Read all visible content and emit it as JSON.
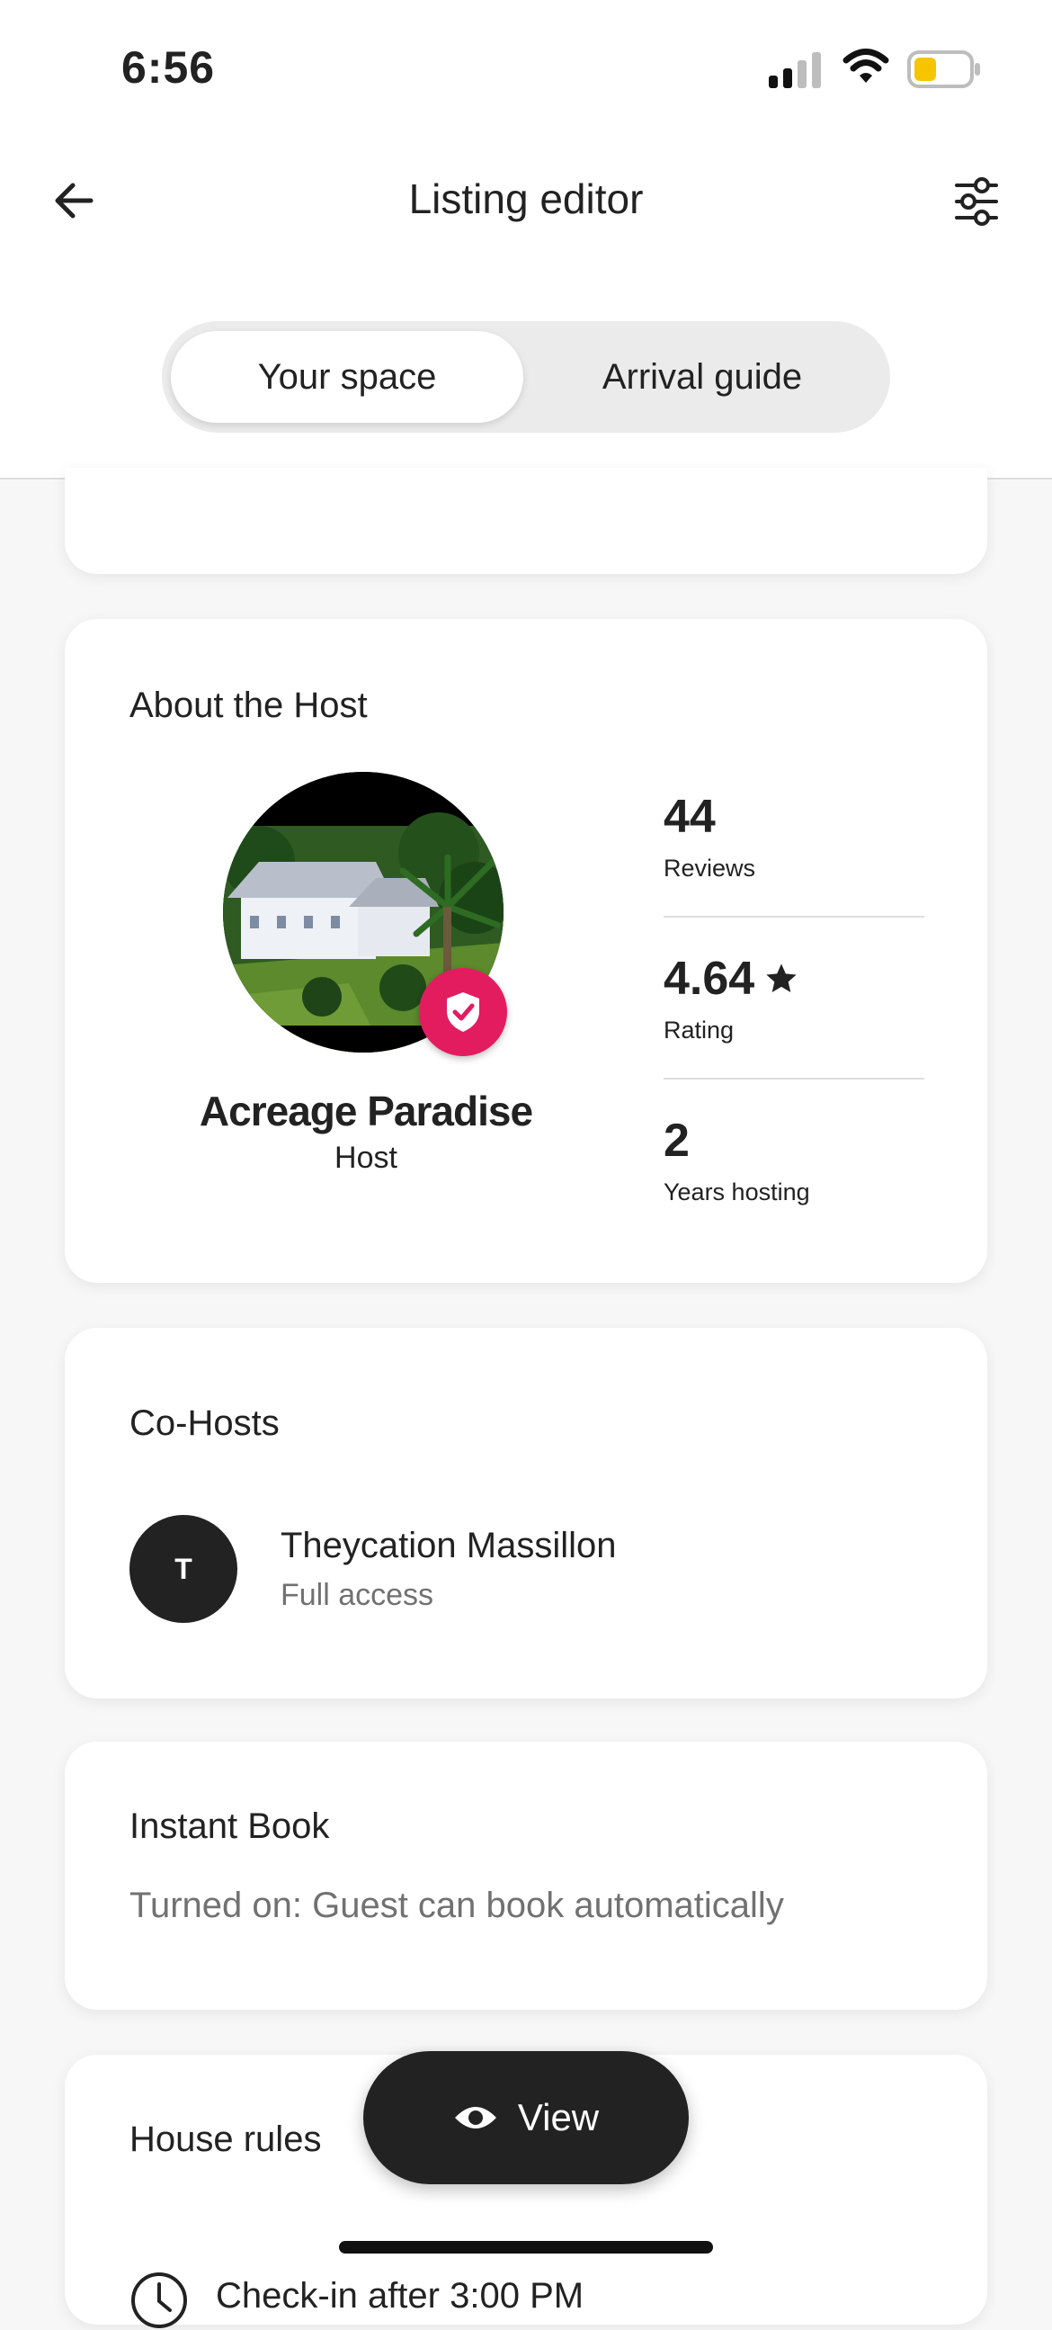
{
  "status_bar": {
    "time": "6:56"
  },
  "header": {
    "title": "Listing editor"
  },
  "tabs": [
    {
      "label": "Your space",
      "selected": true
    },
    {
      "label": "Arrival guide",
      "selected": false
    }
  ],
  "about_host": {
    "title": "About the Host",
    "host_name": "Acreage Paradise",
    "host_role": "Host",
    "stats": [
      {
        "value": "44",
        "label": "Reviews"
      },
      {
        "value": "4.64",
        "label": "Rating"
      },
      {
        "value": "2",
        "label": "Years hosting"
      }
    ]
  },
  "cohosts": {
    "title": "Co-Hosts",
    "items": [
      {
        "initial": "T",
        "name": "Theycation Massillon",
        "access": "Full access"
      }
    ]
  },
  "instant_book": {
    "title": "Instant Book",
    "description": "Turned on: Guest can book automatically"
  },
  "house_rules": {
    "title": "House rules",
    "items": [
      {
        "text": "Check-in after 3:00 PM"
      }
    ]
  },
  "view_button": {
    "label": "View"
  },
  "icons": {
    "back": "arrow-left-icon",
    "filter": "sliders-icon",
    "badge": "shield-check-icon",
    "star": "star-icon",
    "view": "eye-icon",
    "clock": "clock-icon"
  },
  "colors": {
    "accent": "#e31c5f",
    "battery": "#f7c500",
    "text_primary": "#222222",
    "text_secondary": "#717171"
  }
}
